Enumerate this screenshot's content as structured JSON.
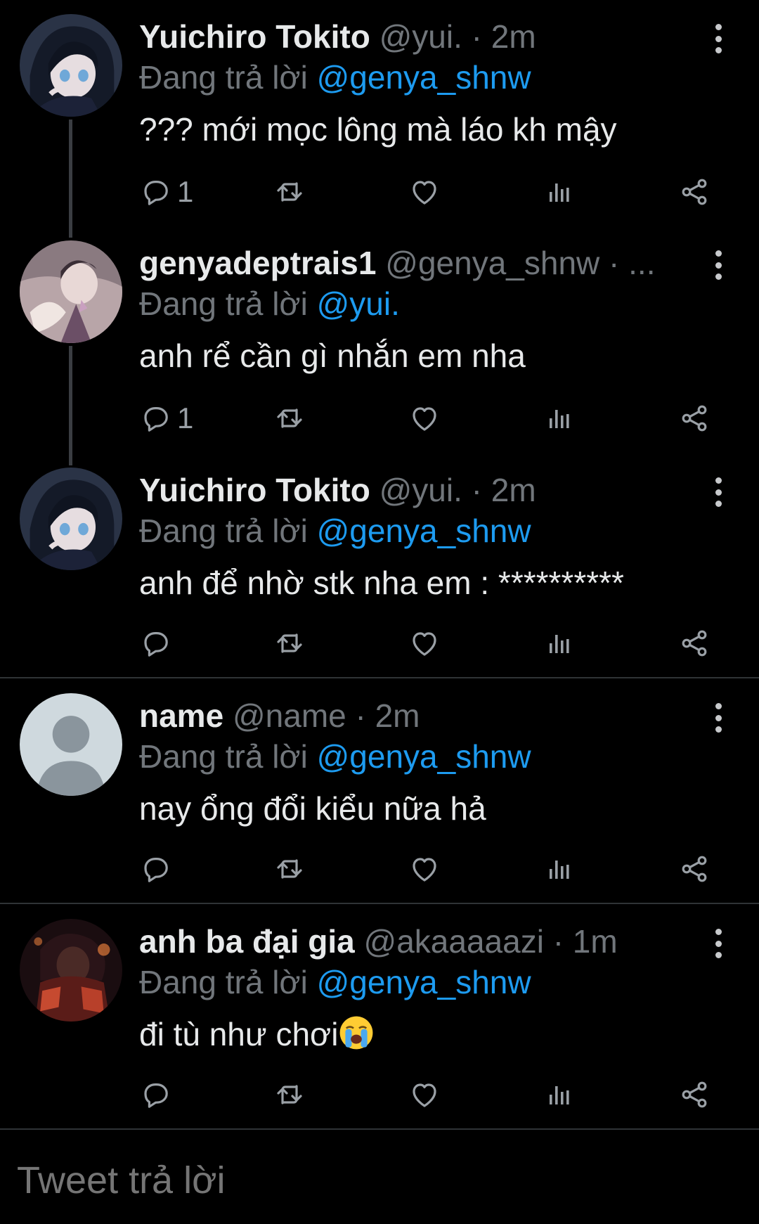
{
  "tweets": [
    {
      "name": "Yuichiro Tokito",
      "meta": "@yui. · 2m",
      "reply_prefix": "Đang trả lời",
      "reply_to": "@genya_shnw",
      "text": "??? mới mọc lông mà láo kh mậy",
      "reply_count": "1",
      "avatar": "anime-dark-hair-avatar"
    },
    {
      "name": "genyadeptrais1",
      "meta": "@genya_shnw · ...",
      "reply_prefix": "Đang trả lời",
      "reply_to": "@yui.",
      "text": "anh rể cần gì nhắn em nha",
      "reply_count": "1",
      "avatar": "anime-pastel-avatar"
    },
    {
      "name": "Yuichiro Tokito",
      "meta": "@yui. · 2m",
      "reply_prefix": "Đang trả lời",
      "reply_to": "@genya_shnw",
      "text": "anh để nhờ stk nha em : **********",
      "reply_count": "",
      "avatar": "anime-dark-hair-avatar"
    },
    {
      "name": "name",
      "meta": "@name · 2m",
      "reply_prefix": "Đang trả lời",
      "reply_to": "@genya_shnw",
      "text": "nay ổng đổi kiểu nữa hả",
      "reply_count": "",
      "avatar": "default-user-avatar"
    },
    {
      "name": "anh ba đại gia",
      "meta": "@akaaaaazi · 1m",
      "reply_prefix": "Đang trả lời",
      "reply_to": "@genya_shnw",
      "text": "đi tù như chơi",
      "reply_count": "",
      "avatar": "anime-red-avatar"
    }
  ],
  "compose": {
    "placeholder": "Tweet trả lời"
  },
  "icons": [
    "reply-icon",
    "retweet-icon",
    "like-icon",
    "views-icon",
    "share-icon",
    "more-icon",
    "crying-face-emoji"
  ],
  "colors": {
    "background": "#000000",
    "mention": "#1d9bf0",
    "muted": "#71767b",
    "text": "#e7e9ea"
  }
}
